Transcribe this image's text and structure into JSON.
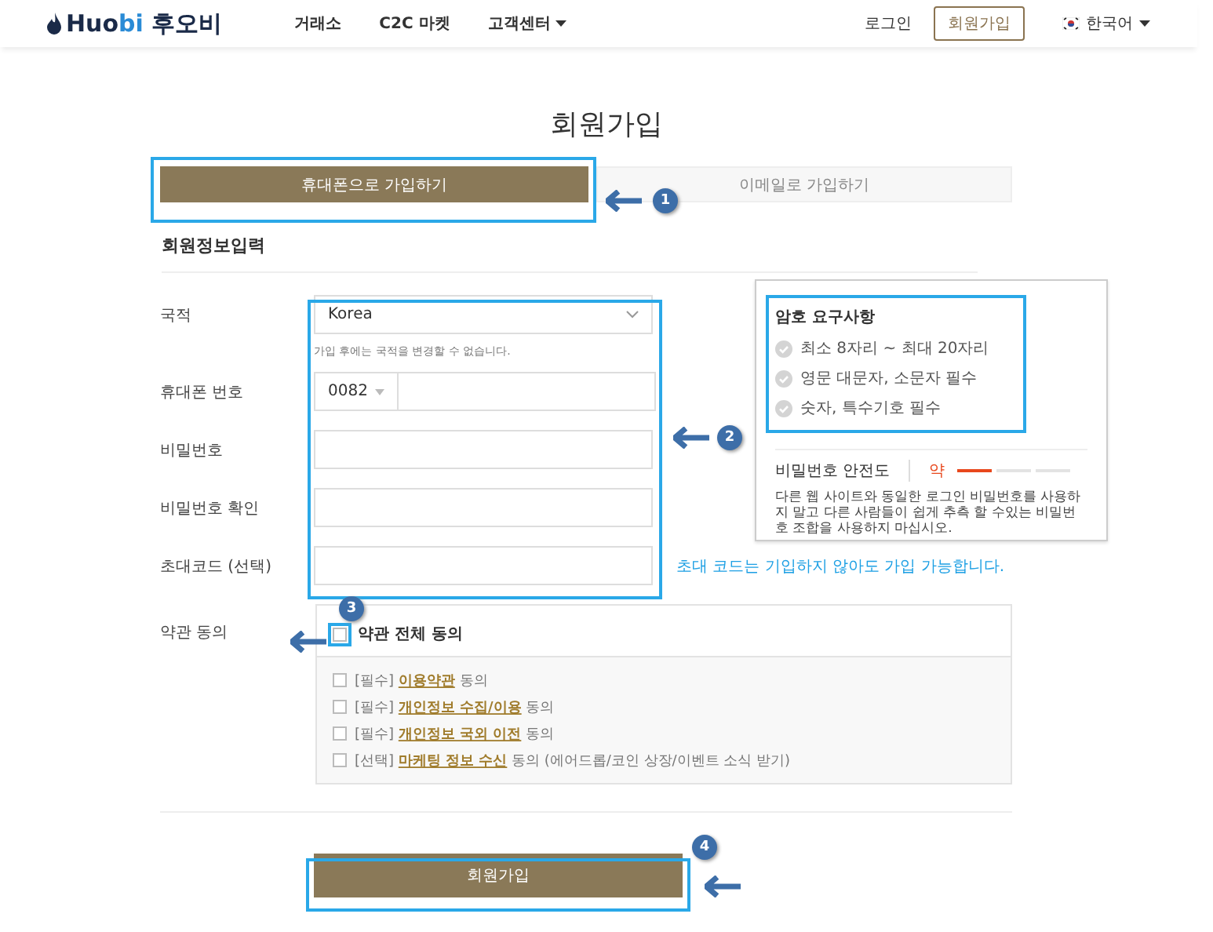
{
  "header": {
    "logo": {
      "main": "Huo",
      "accent": "bi",
      "korean": "후오비"
    },
    "nav": [
      {
        "label": "거래소",
        "dropdown": false
      },
      {
        "label": "C2C 마켓",
        "dropdown": false
      },
      {
        "label": "고객센터",
        "dropdown": true
      }
    ],
    "login": "로그인",
    "signup": "회원가입",
    "language": {
      "label": "한국어",
      "dropdown": true
    }
  },
  "page_title": "회원가입",
  "tabs": [
    {
      "label": "휴대폰으로 가입하기",
      "selected": true
    },
    {
      "label": "이메일로 가입하기",
      "selected": false
    }
  ],
  "section_title": "회원정보입력",
  "fields": [
    {
      "label": "국적",
      "kind": "select",
      "value": "Korea",
      "help": "가입 후에는 국적을 변경할 수 없습니다."
    },
    {
      "label": "휴대폰 번호",
      "kind": "phone",
      "code": "0082"
    },
    {
      "label": "비밀번호",
      "kind": "text"
    },
    {
      "label": "비밀번호 확인",
      "kind": "text"
    },
    {
      "label": "초대코드 (선택)",
      "kind": "text",
      "hint": "초대 코드는 기입하지 않아도 가입 가능합니다."
    }
  ],
  "password_panel": {
    "title": "암호 요구사항",
    "requirements": [
      {
        "text": "최소 8자리 ~ 최대 20자리",
        "met": false
      },
      {
        "text": "영문 대문자, 소문자 필수",
        "met": false
      },
      {
        "text": "숫자, 특수기호 필수",
        "met": false
      }
    ],
    "strength": {
      "label": "비밀번호 안전도",
      "reading": "약",
      "level": 0.33
    },
    "notice": "다른 웹 사이트와 동일한 로그인 비밀번호를 사용하지 말고 다른 사람들이 쉽게 추측 할 수있는 비밀번호 조합을 사용하지 마십시오."
  },
  "terms": {
    "label": "약관 동의",
    "all": {
      "text": "약관 전체 동의",
      "checked": false
    },
    "items": [
      {
        "tag": "[필수]",
        "link": "이용약관",
        "suffix": "동의",
        "checked": false
      },
      {
        "tag": "[필수]",
        "link": "개인정보 수집/이용",
        "suffix": "동의",
        "checked": false
      },
      {
        "tag": "[필수]",
        "link": "개인정보 국외 이전",
        "suffix": "동의",
        "checked": false
      },
      {
        "tag": "[선택]",
        "link": "마케팅 정보 수신",
        "suffix": "동의 (에어드롭/코인 상장/이벤트 소식 받기)",
        "checked": false
      }
    ]
  },
  "submit": "회원가입",
  "annotations": [
    {
      "number": "1"
    },
    {
      "number": "2"
    },
    {
      "number": "3"
    },
    {
      "number": "4"
    }
  ]
}
